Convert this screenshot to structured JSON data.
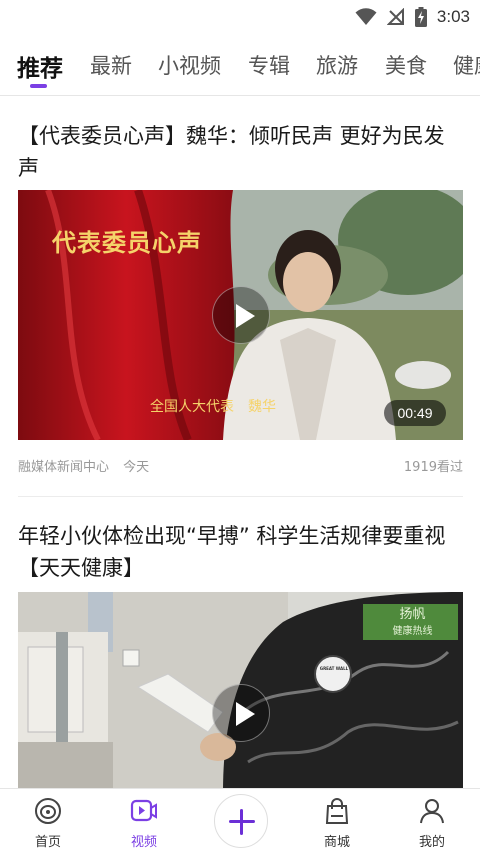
{
  "status_bar": {
    "time": "3:03",
    "icons": [
      "wifi-icon",
      "no-signal-icon",
      "battery-charging-icon"
    ]
  },
  "tabs": [
    {
      "label": "推荐",
      "active": true
    },
    {
      "label": "最新",
      "active": false
    },
    {
      "label": "小视频",
      "active": false
    },
    {
      "label": "专辑",
      "active": false
    },
    {
      "label": "旅游",
      "active": false
    },
    {
      "label": "美食",
      "active": false
    },
    {
      "label": "健康",
      "active": false
    }
  ],
  "feed": [
    {
      "title": "【代表委员心声】魏华：倾听民声 更好为民发声",
      "overlay_heading": "代表委员心声",
      "overlay_caption": "全国人大代表　魏华",
      "duration": "00:49",
      "source": "融媒体新闻中心",
      "time": "今天",
      "views": "1919看过"
    },
    {
      "title": "年轻小伙体检出现“早搏” 科学生活规律要重视【天天健康】",
      "overlay_logo": "扬帆",
      "overlay_logo_sub": "健康热线",
      "shirt_text": "GREAT WALL"
    }
  ],
  "bottom_nav": [
    {
      "label": "首页",
      "icon": "home-icon",
      "active": false
    },
    {
      "label": "视频",
      "icon": "video-icon",
      "active": true
    },
    {
      "label": "",
      "icon": "plus-icon",
      "active": false
    },
    {
      "label": "商城",
      "icon": "shopping-bag-icon",
      "active": false
    },
    {
      "label": "我的",
      "icon": "profile-icon",
      "active": false
    }
  ],
  "colors": {
    "accent": "#7b3fe4",
    "curtain_red": "#b3121b",
    "caption_gold": "#f5d36a"
  }
}
